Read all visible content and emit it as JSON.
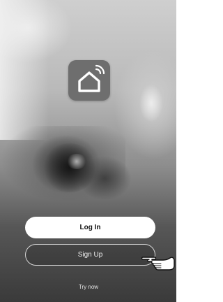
{
  "app": {
    "logo_icon": "smart-home-icon",
    "logo_color": "#6e6e6e"
  },
  "actions": {
    "login_label": "Log In",
    "signup_label": "Sign Up",
    "try_now_label": "Try now"
  },
  "overlay": {
    "pointer_icon": "hand-pointer-icon"
  },
  "colors": {
    "primary_button_bg": "#ffffff",
    "primary_button_text": "#111111",
    "secondary_button_border": "#e6e6e6",
    "secondary_button_text": "#f2f2f2"
  }
}
